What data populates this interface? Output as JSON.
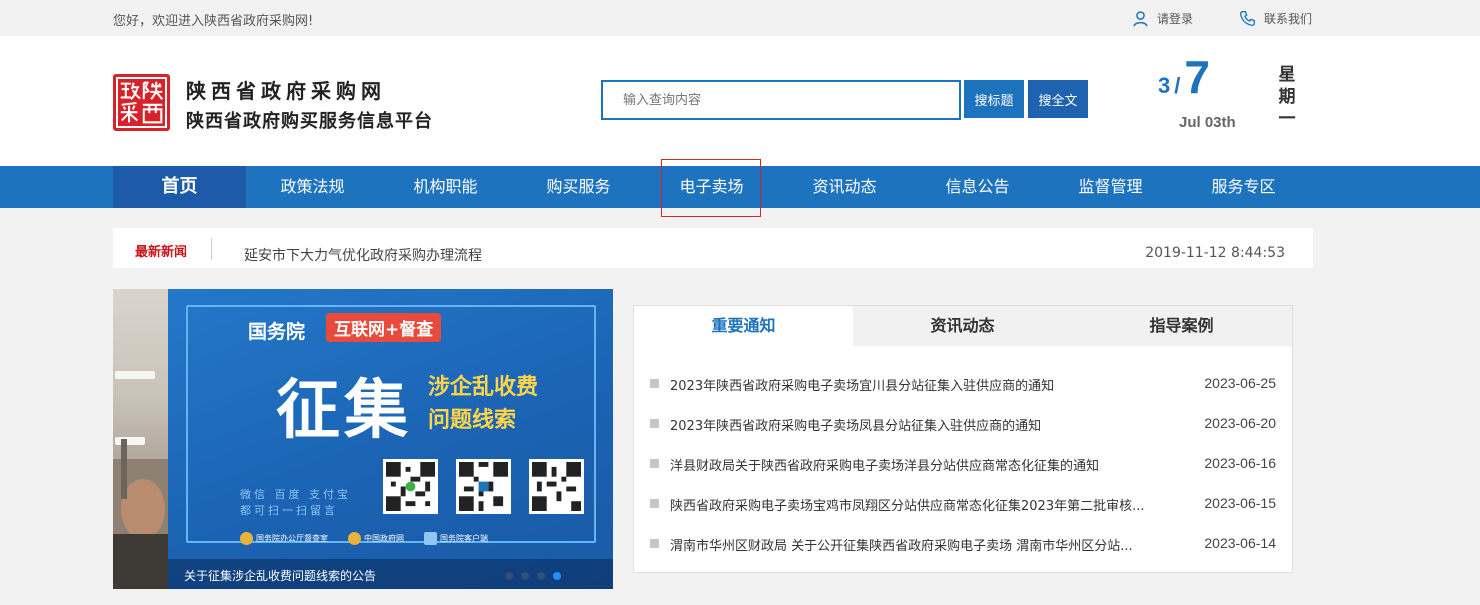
{
  "topbar": {
    "welcome": "您好，欢迎进入陕西省政府采购网!",
    "login": "请登录",
    "contact": "联系我们"
  },
  "logo": {
    "title": "陕西省政府采购网",
    "subtitle": "陕西省政府购买服务信息平台",
    "seal_text": "政陕采西"
  },
  "search": {
    "placeholder": "输入查询内容",
    "btn_title": "搜标题",
    "btn_full": "搜全文"
  },
  "date": {
    "month": "3",
    "sep": "/",
    "day": "7",
    "english": "Jul 03th",
    "weekday": "星期一"
  },
  "nav": [
    "首页",
    "政策法规",
    "机构职能",
    "购买服务",
    "电子卖场",
    "资讯动态",
    "信息公告",
    "监督管理",
    "服务专区"
  ],
  "ticker": {
    "label": "最新新闻",
    "text": "延安市下大力气优化政府采购办理流程",
    "time": "2019-11-12 8:44:53"
  },
  "banner": {
    "gov": "国务院",
    "tag": "互联网+督查",
    "big": "征集",
    "sub1": "涉企乱收费",
    "sub2": "问题线索",
    "hint1": "微信 百度 支付宝",
    "hint2": "都可扫一扫留言",
    "org1": "国务院办公厅督查室",
    "org2": "中国政府网",
    "org3": "国务院客户端",
    "caption": "关于征集涉企乱收费问题线索的公告",
    "slide_index": 4,
    "slide_count": 4
  },
  "panel": {
    "tabs": [
      "重要通知",
      "资讯动态",
      "指导案例"
    ],
    "notices": [
      {
        "title": "2023年陕西省政府采购电子卖场宜川县分站征集入驻供应商的通知",
        "date": "2023-06-25"
      },
      {
        "title": "2023年陕西省政府采购电子卖场凤县分站征集入驻供应商的通知",
        "date": "2023-06-20"
      },
      {
        "title": "洋县财政局关于陕西省政府采购电子卖场洋县分站供应商常态化征集的通知",
        "date": "2023-06-16"
      },
      {
        "title": "陕西省政府采购电子卖场宝鸡市凤翔区分站供应商常态化征集2023年第二批审核...",
        "date": "2023-06-15"
      },
      {
        "title": "渭南市华州区财政局 关于公开征集陕西省政府采购电子卖场 渭南市华州区分站...",
        "date": "2023-06-14"
      }
    ]
  },
  "colors": {
    "brand_blue": "#1e73be",
    "brand_red": "#d8222a",
    "nav_active": "#1d5aa8"
  }
}
